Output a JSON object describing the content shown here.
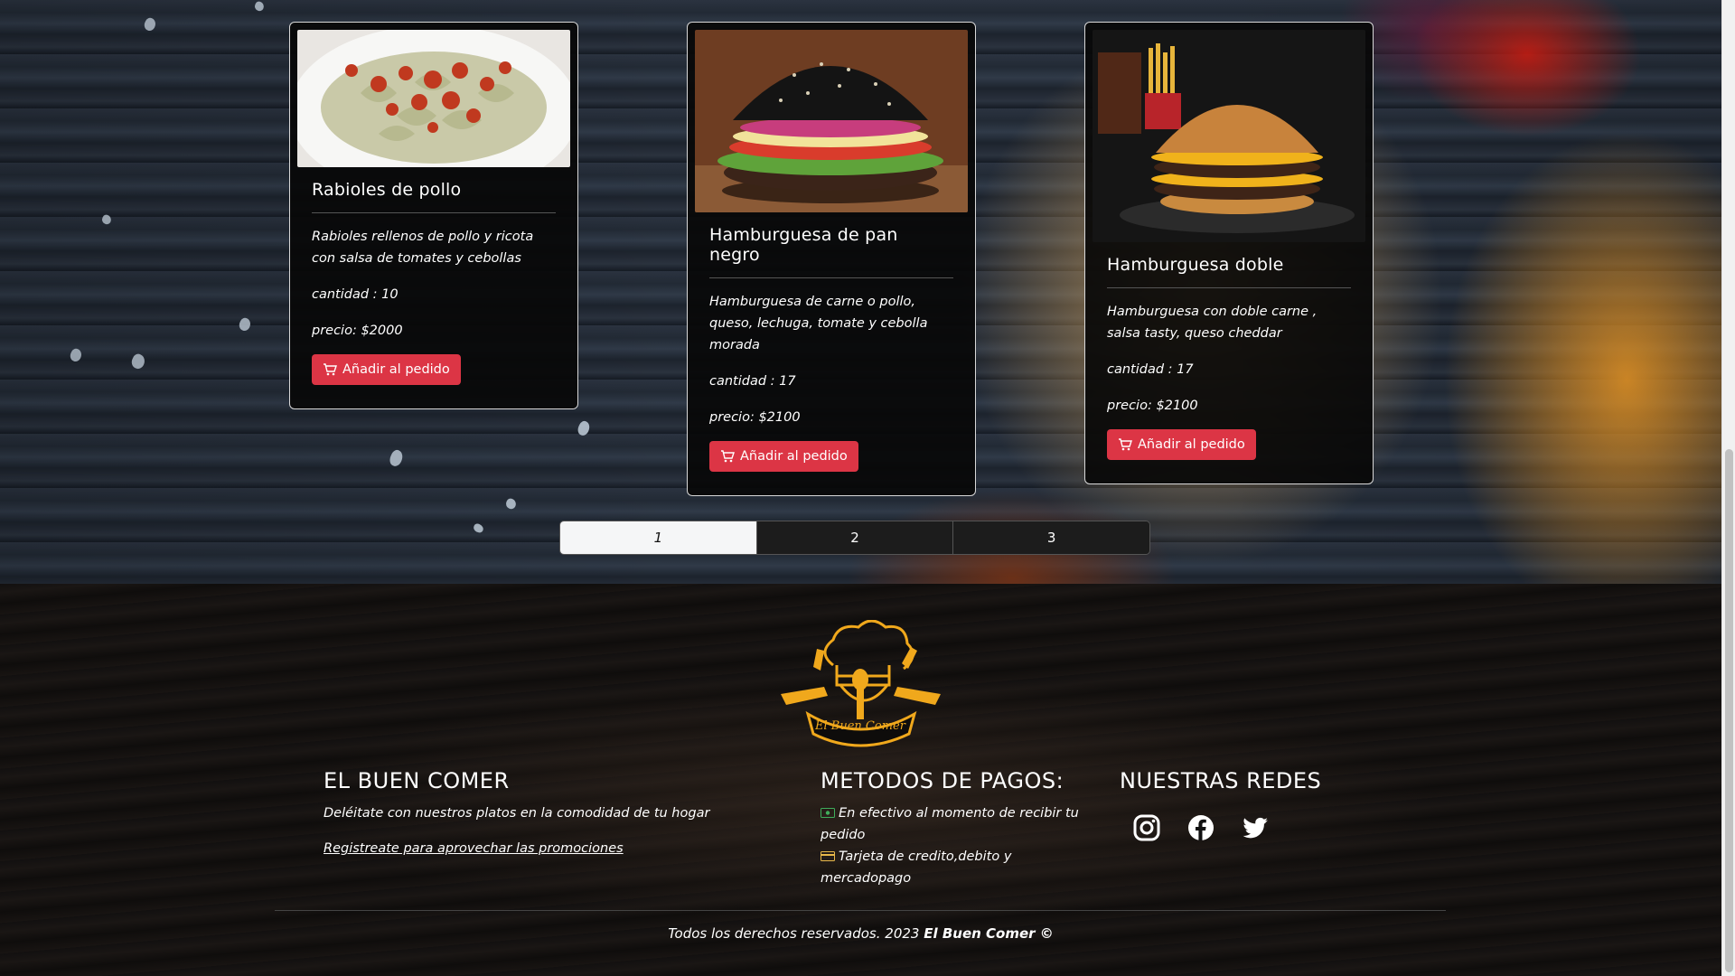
{
  "products": [
    {
      "title": "Rabioles de pollo",
      "description": "Rabioles rellenos de pollo y ricota con salsa de tomates y cebollas",
      "quantity": "cantidad : 10",
      "price": "precio: $2000",
      "button_label": "Añadir al pedido",
      "image_icon": "ravioli-dish"
    },
    {
      "title": "Hamburguesa de pan negro",
      "description": "Hamburguesa de carne o pollo, queso, lechuga, tomate y cebolla morada",
      "quantity": "cantidad : 17",
      "price": "precio: $2100",
      "button_label": "Añadir al pedido",
      "image_icon": "black-bun-burger"
    },
    {
      "title": "Hamburguesa doble",
      "description": "Hamburguesa con doble carne , salsa tasty, queso cheddar",
      "quantity": "cantidad : 17",
      "price": "precio: $2100",
      "button_label": "Añadir al pedido",
      "image_icon": "double-burger"
    }
  ],
  "pagination": {
    "pages": [
      "1",
      "2",
      "3"
    ],
    "current": "1"
  },
  "footer": {
    "logo_text": "El Buen Comer",
    "brand": {
      "heading": "EL BUEN COMER",
      "tagline": "Deléitate con nuestros platos en la comodidad de tu hogar",
      "register_link": "Registreate para aprovechar las promociones"
    },
    "payments": {
      "heading": "METODOS DE PAGOS:",
      "cash": "En efectivo al momento de recibir tu pedido",
      "card": "Tarjeta de credito,debito y mercadopago"
    },
    "social": {
      "heading": "NUESTRAS REDES",
      "icons": [
        "instagram-icon",
        "facebook-icon",
        "twitter-icon"
      ]
    },
    "copyright_prefix": "Todos los derechos reservados. 2023",
    "copyright_brand": "El Buen Comer ©"
  },
  "colors": {
    "button_red": "#dc3545",
    "logo_gold": "#f0a81c",
    "card_bg": "#0a0a0a",
    "cash_icon_green": "#3fae5b",
    "card_icon_gold": "#e8b84a"
  }
}
